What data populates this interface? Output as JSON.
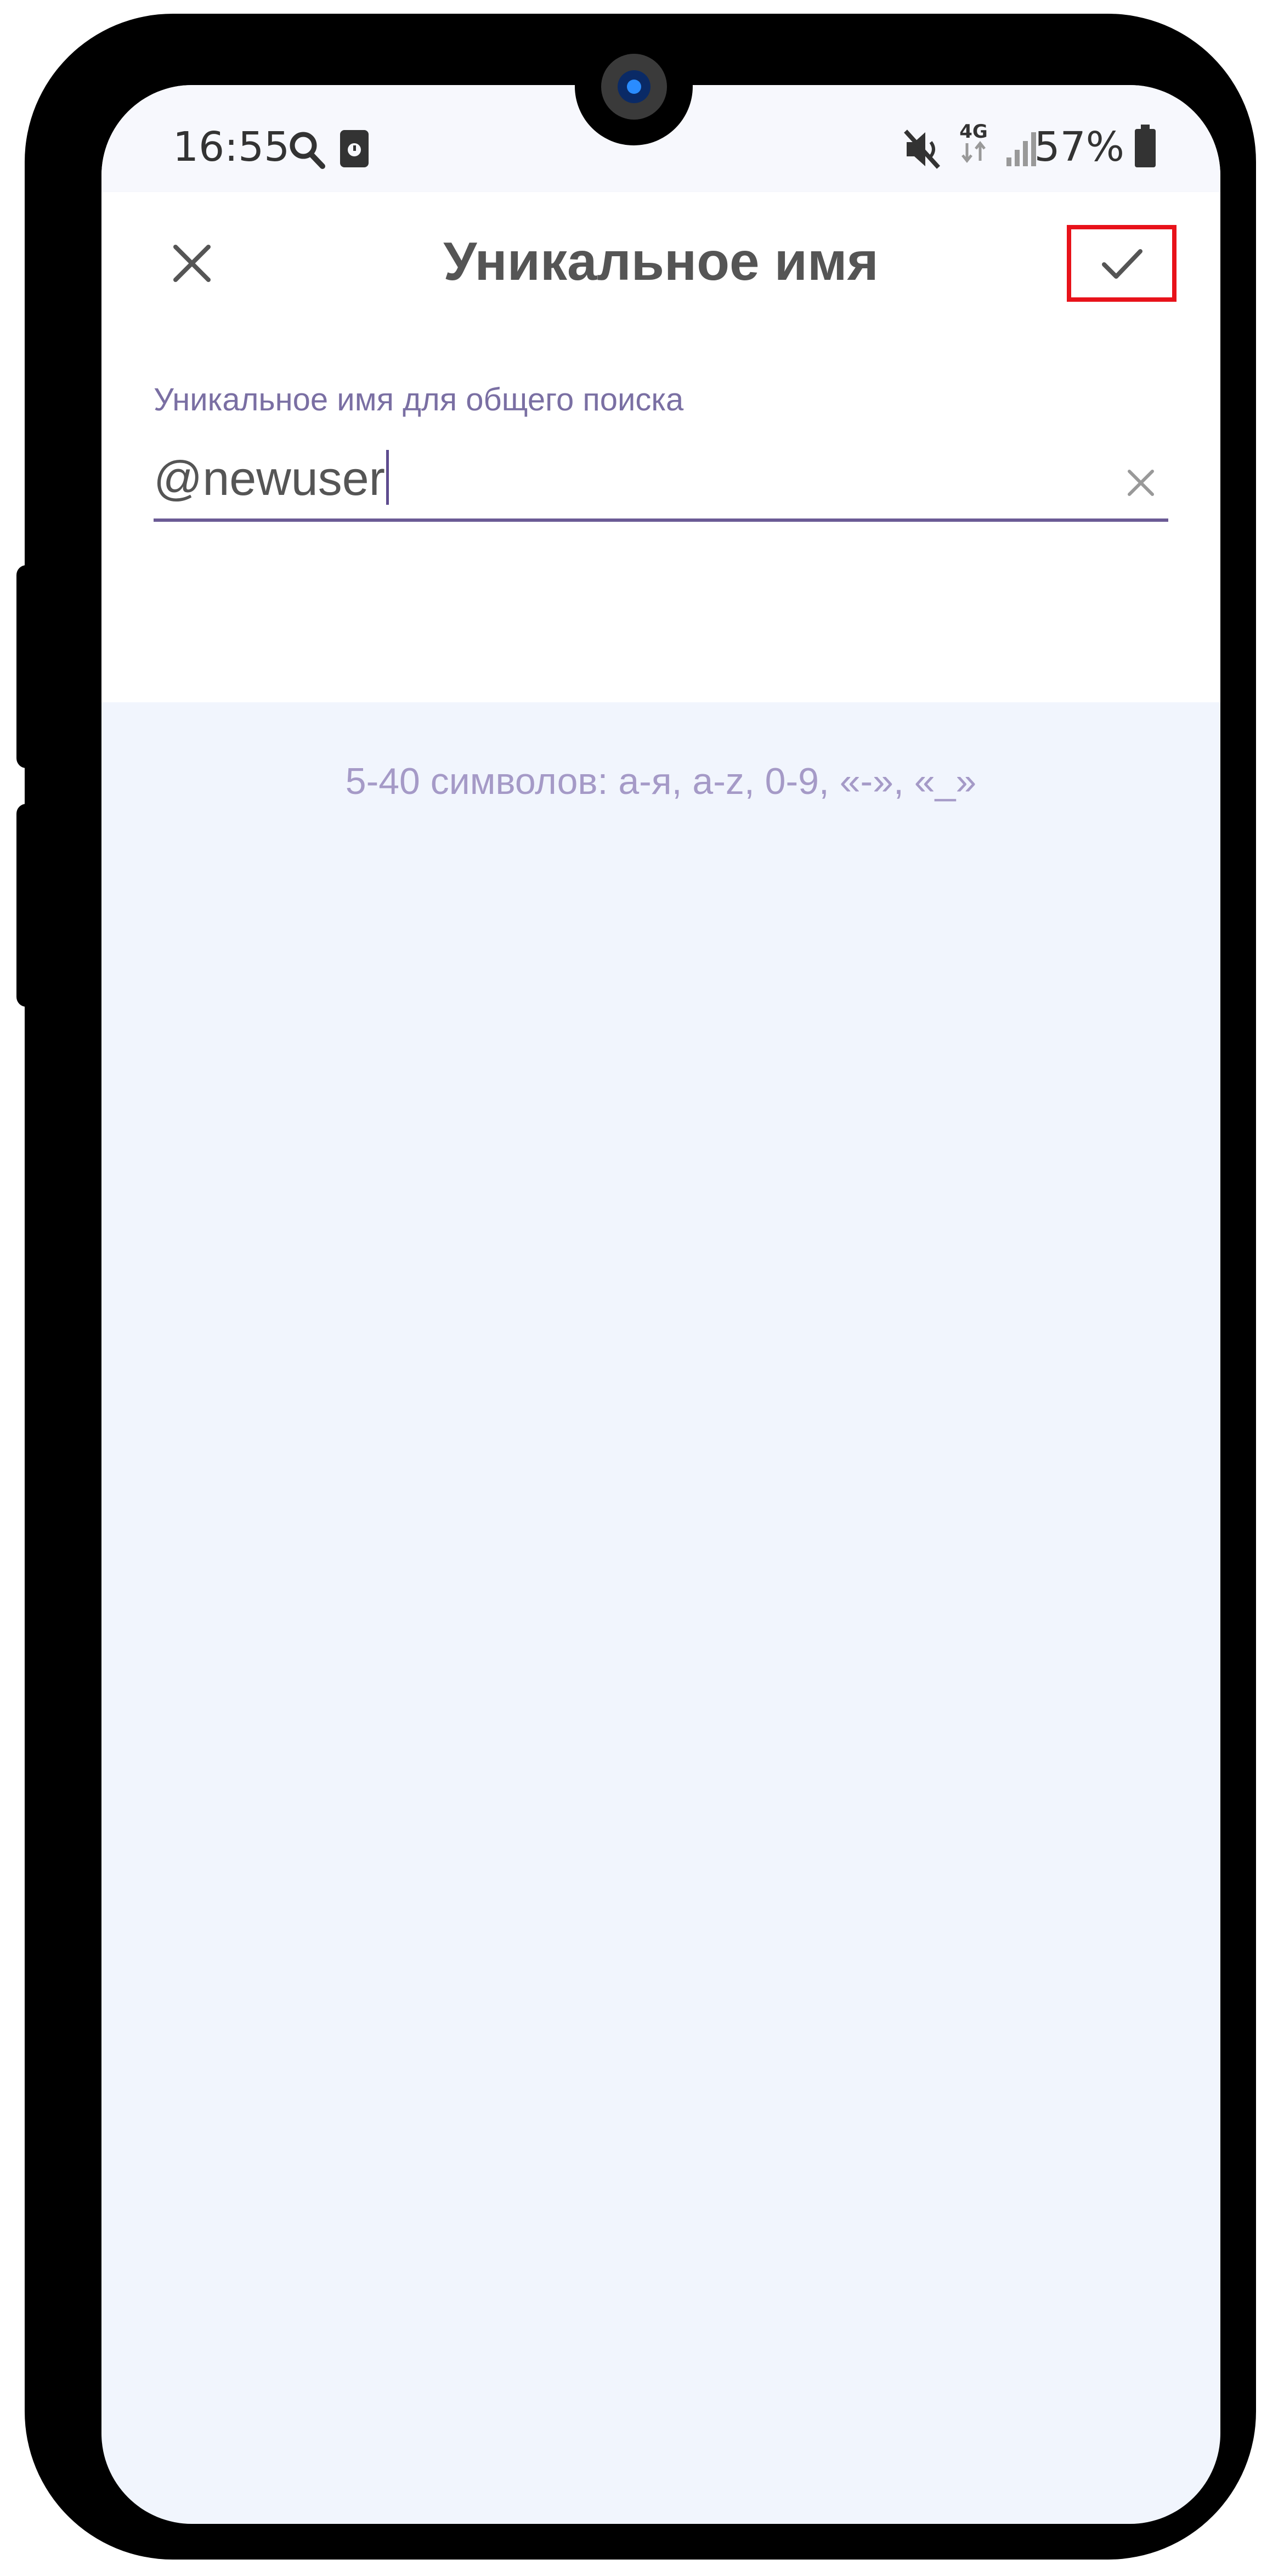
{
  "status_bar": {
    "time": "16:55",
    "battery_percent": "57%",
    "network_label": "4G",
    "icons": [
      "search-icon",
      "notification-icon",
      "mute-icon",
      "signal-icon",
      "battery-icon"
    ]
  },
  "toolbar": {
    "title": "Уникальное имя",
    "close_icon": "close-icon",
    "confirm_icon": "check-icon",
    "highlight_color": "#e8121a"
  },
  "username_field": {
    "label": "Уникальное имя для общего поиска",
    "value": "@newuser",
    "clear_icon": "clear-icon",
    "accent_color": "#6b5b95"
  },
  "hint": {
    "text": "5-40 символов: а-я, a-z, 0-9, «-», «_»"
  },
  "colors": {
    "phone_frame": "#000000",
    "screen_background": "#f1f5fd"
  }
}
